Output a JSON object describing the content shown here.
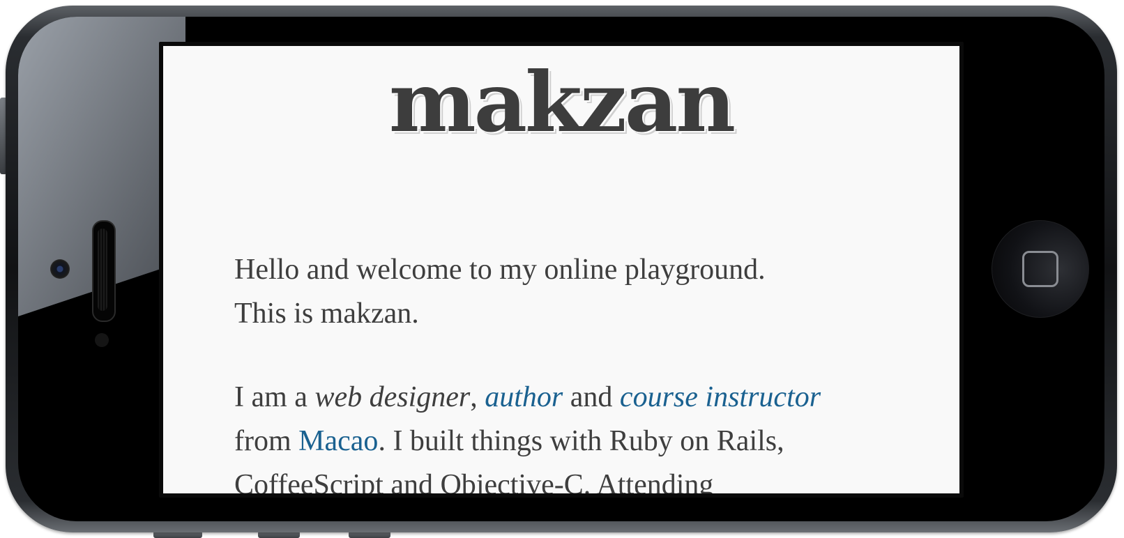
{
  "site": {
    "title": "makzan"
  },
  "intro": {
    "line1": "Hello and welcome to my online playground.",
    "line2": "This is makzan."
  },
  "bio": {
    "prefix": "I am a ",
    "role_web_designer": "web designer",
    "comma": ", ",
    "link_author": "author",
    "and": " and ",
    "link_course_instructor": "course instructor",
    "from": "from ",
    "link_macao": "Macao",
    "after_macao": ". I built things with Ruby on Rails,",
    "line3": "CoffeeScript and Objective-C. Attending"
  },
  "colors": {
    "link": "#1a6190",
    "text": "#3e3e3e",
    "background": "#f9f9f9"
  },
  "device": {
    "home_button_icon": "home-square-icon",
    "camera_icon": "front-camera-icon",
    "speaker_icon": "earpiece-speaker-icon"
  }
}
